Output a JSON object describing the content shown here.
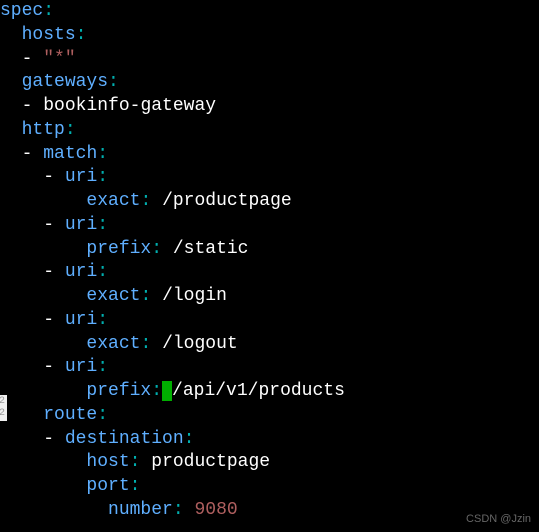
{
  "yaml": {
    "spec": "spec",
    "hosts": "hosts",
    "hostValue": "\"*\"",
    "gateways": "gateways",
    "gatewayValue": "bookinfo-gateway",
    "http": "http",
    "match": "match",
    "uri": "uri",
    "exact": "exact",
    "prefix": "prefix",
    "route": "route",
    "destination": "destination",
    "host": "host",
    "port": "port",
    "number": "number",
    "paths": {
      "productpage": "/productpage",
      "static": "/static",
      "login": "/login",
      "logout": "/logout",
      "api": "/api/v1/products"
    },
    "destHost": "productpage",
    "portNumber": "9080"
  },
  "watermark": "CSDN @Jzin"
}
